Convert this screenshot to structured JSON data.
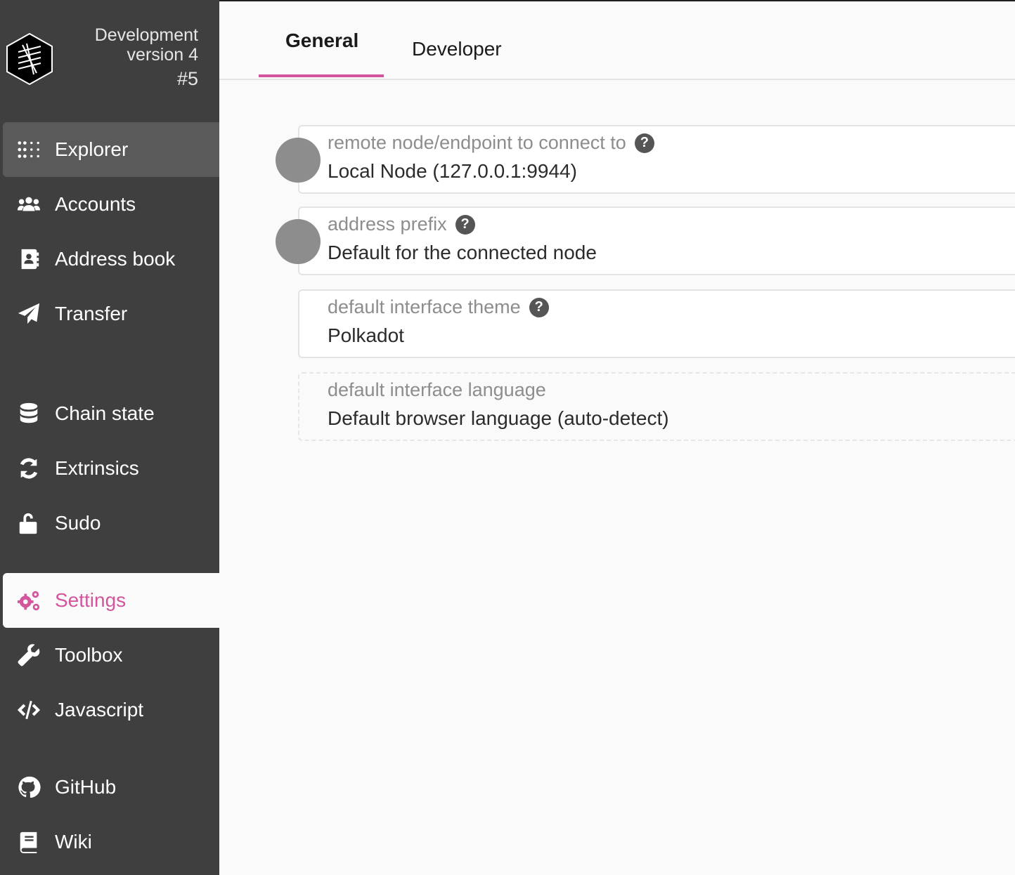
{
  "chain": {
    "name": "Development",
    "version": "version 4",
    "block": "#5"
  },
  "sidebar": {
    "items": [
      {
        "label": "Explorer",
        "icon": "grid-dots-icon"
      },
      {
        "label": "Accounts",
        "icon": "users-icon"
      },
      {
        "label": "Address book",
        "icon": "address-book-icon"
      },
      {
        "label": "Transfer",
        "icon": "paper-plane-icon"
      },
      {
        "label": "Chain state",
        "icon": "database-icon"
      },
      {
        "label": "Extrinsics",
        "icon": "sync-icon"
      },
      {
        "label": "Sudo",
        "icon": "unlock-icon"
      },
      {
        "label": "Settings",
        "icon": "cogs-icon"
      },
      {
        "label": "Toolbox",
        "icon": "wrench-icon"
      },
      {
        "label": "Javascript",
        "icon": "code-icon"
      },
      {
        "label": "GitHub",
        "icon": "github-icon"
      },
      {
        "label": "Wiki",
        "icon": "book-icon"
      }
    ]
  },
  "tabs": [
    {
      "label": "General"
    },
    {
      "label": "Developer"
    }
  ],
  "settings": {
    "endpoint": {
      "label": "remote node/endpoint to connect to",
      "value": "Local Node (127.0.0.1:9944)"
    },
    "prefix": {
      "label": "address prefix",
      "value": "Default for the connected node"
    },
    "theme": {
      "label": "default interface theme",
      "value": "Polkadot"
    },
    "language": {
      "label": "default interface language",
      "value": "Default browser language (auto-detect)"
    }
  },
  "colors": {
    "accent": "#d3569c",
    "sidebar_bg": "#3f3f3f",
    "active_item_bg": "#5a5a5a"
  }
}
